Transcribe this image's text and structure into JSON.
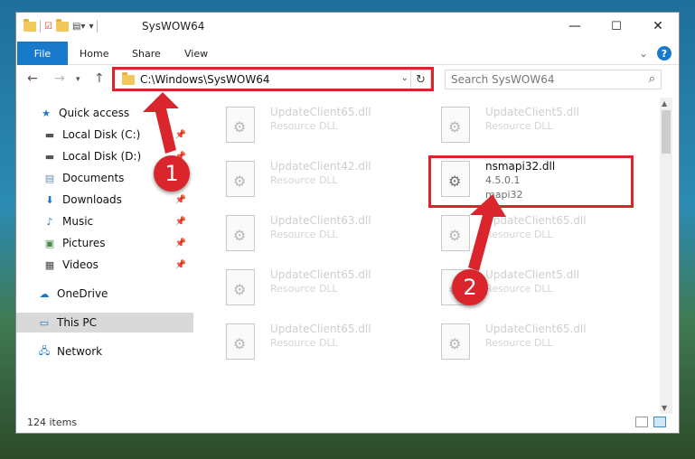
{
  "window": {
    "title": "SysWOW64"
  },
  "window_controls": {
    "minimize": "—",
    "maximize": "☐",
    "close": "✕"
  },
  "ribbon": {
    "tabs": [
      "File",
      "Home",
      "Share",
      "View"
    ],
    "help": "?"
  },
  "address_bar": {
    "path": "C:\\Windows\\SysWOW64"
  },
  "search": {
    "placeholder": "Search SysWOW64"
  },
  "navigation": {
    "items": [
      {
        "label": "Quick access",
        "icon": "star-icon",
        "pinned": false
      },
      {
        "label": "Local Disk (C:)",
        "icon": "drive-icon",
        "pinned": true
      },
      {
        "label": "Local Disk (D:)",
        "icon": "drive-icon",
        "pinned": true
      },
      {
        "label": "Documents",
        "icon": "documents-icon",
        "pinned": true
      },
      {
        "label": "Downloads",
        "icon": "download-icon",
        "pinned": true
      },
      {
        "label": "Music",
        "icon": "music-icon",
        "pinned": true
      },
      {
        "label": "Pictures",
        "icon": "pictures-icon",
        "pinned": true
      },
      {
        "label": "Videos",
        "icon": "videos-icon",
        "pinned": true
      },
      {
        "label": "OneDrive",
        "icon": "cloud-icon",
        "pinned": false
      },
      {
        "label": "This PC",
        "icon": "computer-icon",
        "pinned": false,
        "selected": true
      },
      {
        "label": "Network",
        "icon": "network-icon",
        "pinned": false
      }
    ]
  },
  "files": [
    {
      "name": "UpdateClient65.dll",
      "desc": "Resource DLL",
      "highlighted": false
    },
    {
      "name": "UpdateClient5.dll",
      "desc": "Resource DLL",
      "highlighted": false
    },
    {
      "name": "UpdateClient42.dll",
      "desc": "Resource DLL",
      "highlighted": false
    },
    {
      "name": "nsmapi32.dll",
      "desc": "4.5.0.1",
      "desc2": "mapi32",
      "highlighted": true
    },
    {
      "name": "UpdateClient63.dll",
      "desc": "Resource DLL",
      "highlighted": false
    },
    {
      "name": "UpdateClient65.dll",
      "desc": "Resource DLL",
      "highlighted": false
    },
    {
      "name": "UpdateClient65.dll",
      "desc": "Resource DLL",
      "highlighted": false
    },
    {
      "name": "UpdateClient5.dll",
      "desc": "Resource DLL",
      "highlighted": false
    },
    {
      "name": "UpdateClient65.dll",
      "desc": "Resource DLL",
      "highlighted": false
    },
    {
      "name": "UpdateClient65.dll",
      "desc": "Resource DLL",
      "highlighted": false
    }
  ],
  "status": {
    "item_count": "124 items"
  },
  "annotations": {
    "step1": "1",
    "step2": "2",
    "color": "#d9252b"
  }
}
